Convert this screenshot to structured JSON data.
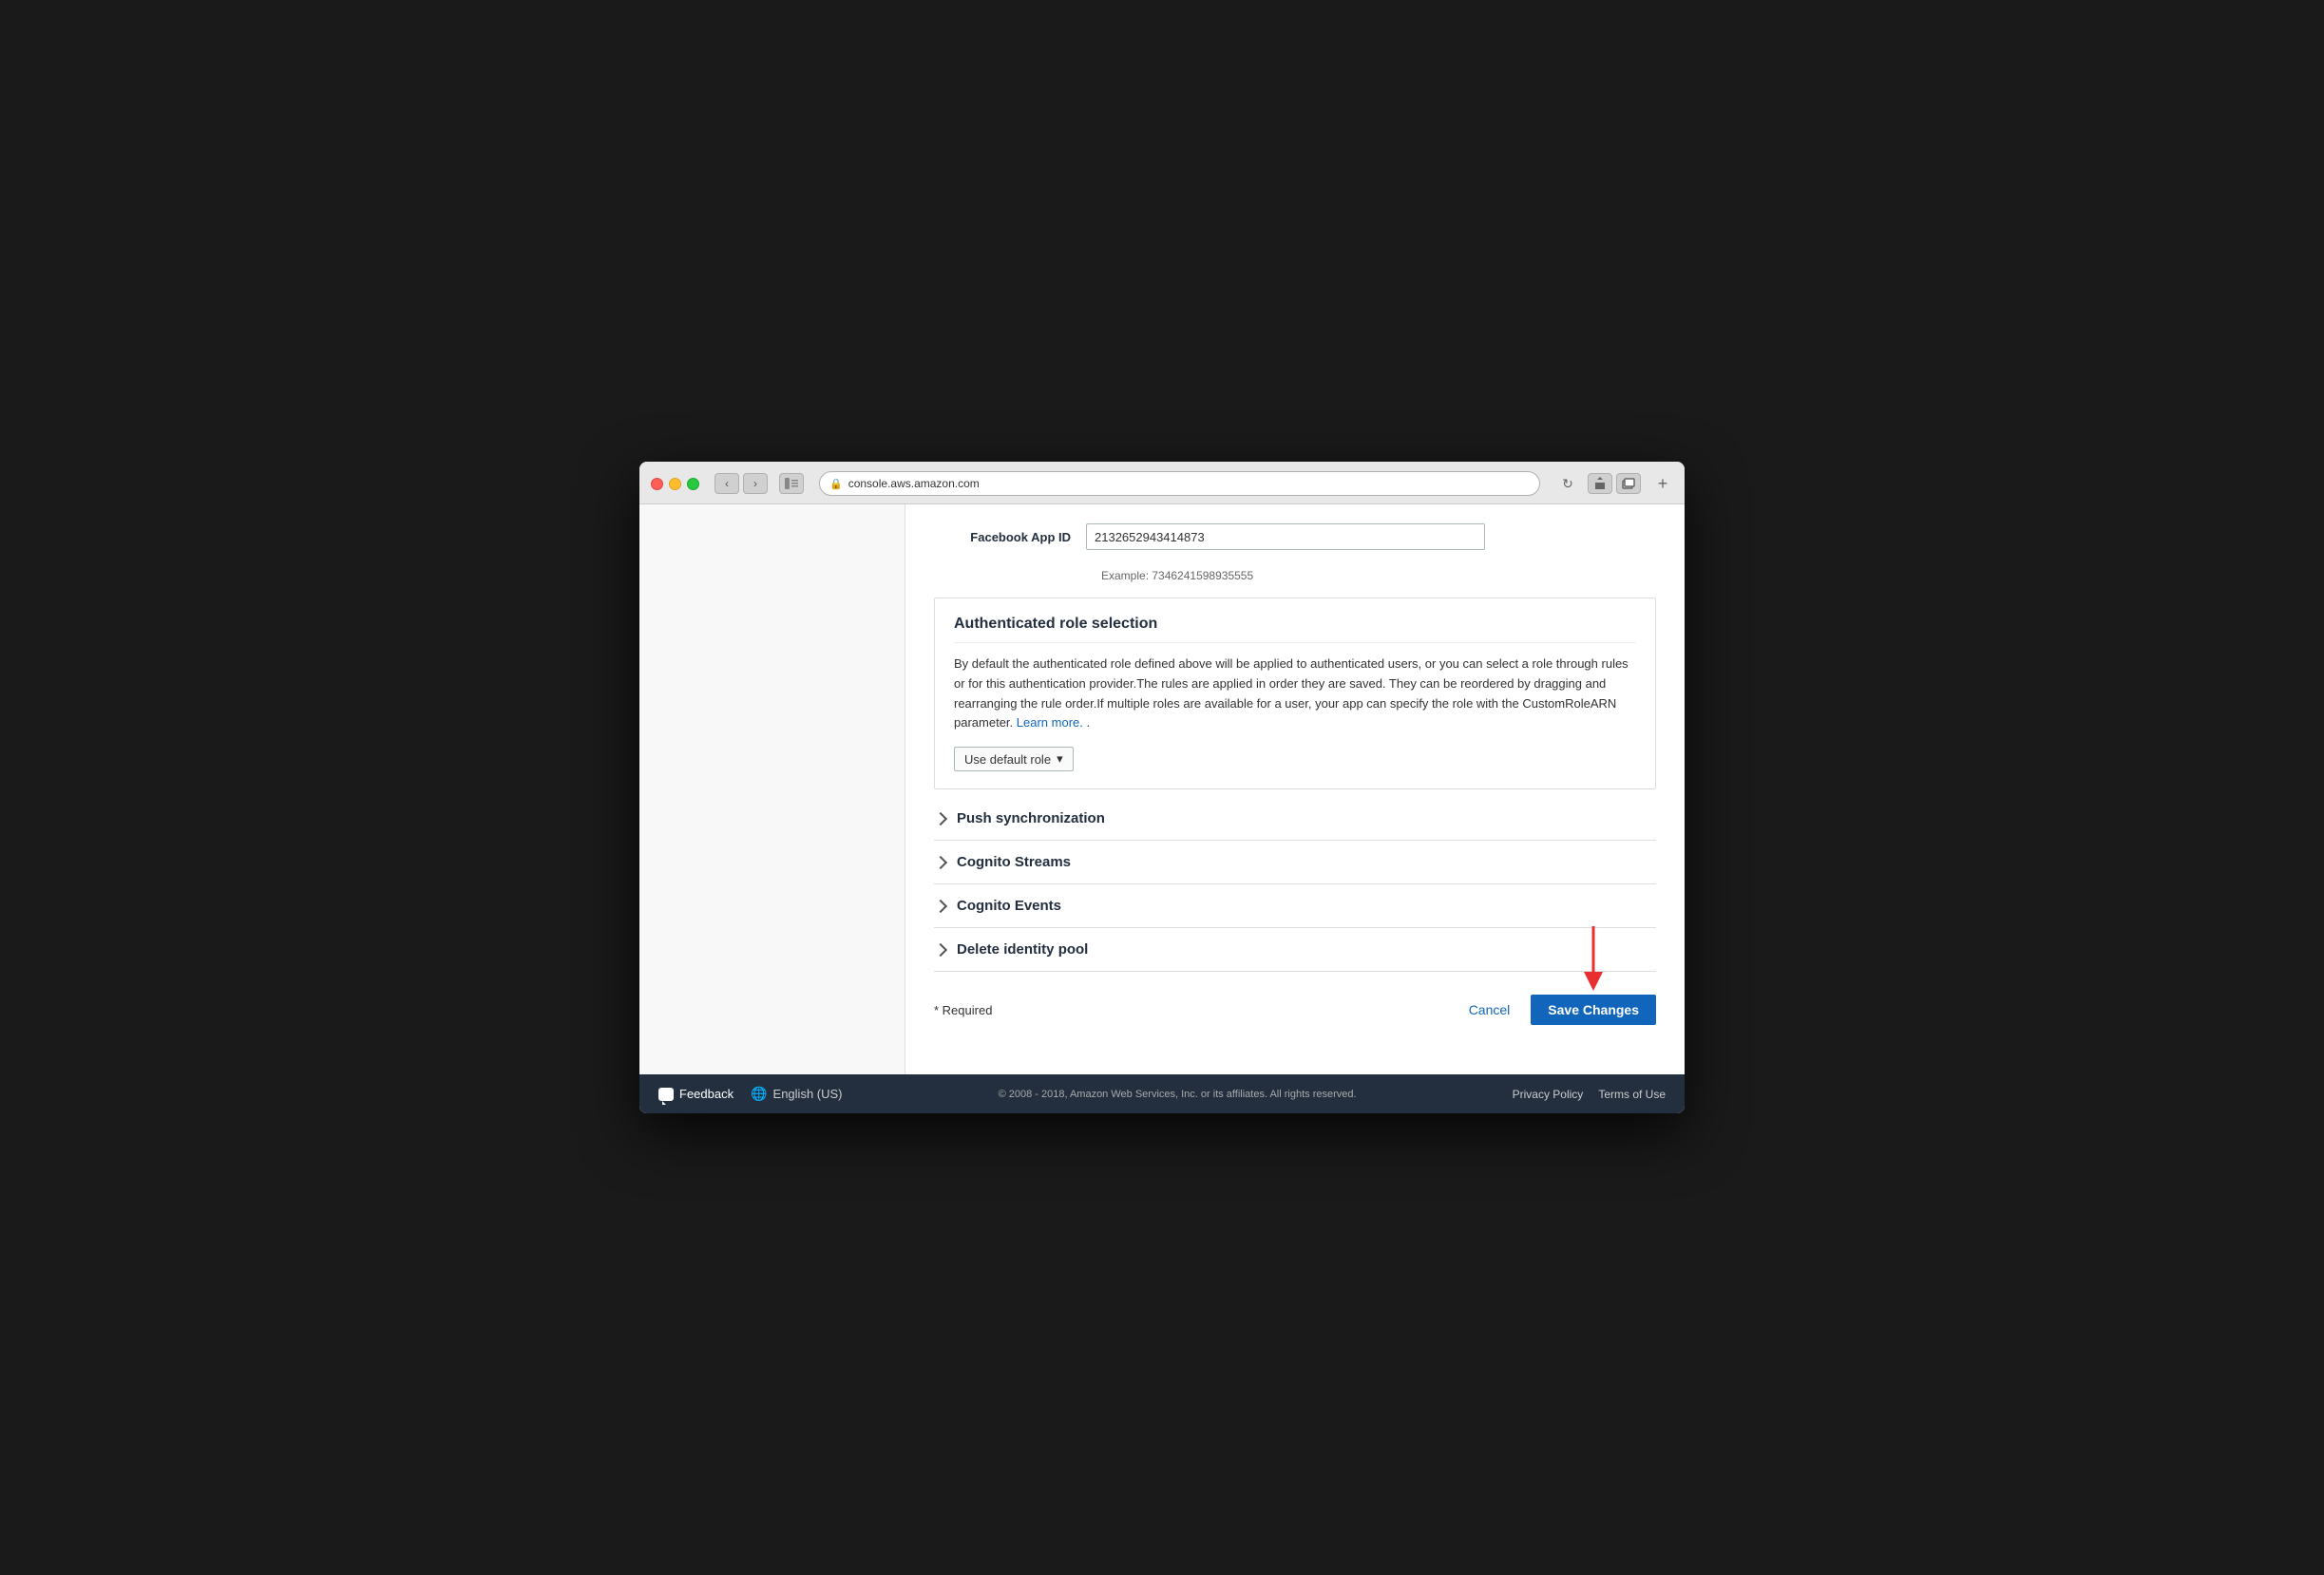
{
  "browser": {
    "url": "console.aws.amazon.com",
    "traffic_lights": [
      "red",
      "yellow",
      "green"
    ]
  },
  "page": {
    "facebook_app_id_label": "Facebook App ID",
    "facebook_app_id_value": "2132652943414873",
    "facebook_app_id_example": "Example: 7346241598935555",
    "authenticated_role_section": {
      "title": "Authenticated role selection",
      "description": "By default the authenticated role defined above will be applied to authenticated users, or you can select a role through rules or for this authentication provider.The rules are applied in order they are saved. They can be reordered by dragging and rearranging the rule order.If multiple roles are available for a user, your app can specify the role with the CustomRoleARN parameter.",
      "learn_more_text": "Learn more.",
      "default_role_btn": "Use default role"
    },
    "collapsible_sections": [
      {
        "label": "Push synchronization"
      },
      {
        "label": "Cognito Streams"
      },
      {
        "label": "Cognito Events"
      },
      {
        "label": "Delete identity pool"
      }
    ],
    "required_note": "* Required",
    "cancel_label": "Cancel",
    "save_label": "Save Changes"
  },
  "footer": {
    "feedback_label": "Feedback",
    "language_label": "English (US)",
    "copyright": "© 2008 - 2018, Amazon Web Services, Inc. or its affiliates. All rights reserved.",
    "privacy_policy": "Privacy Policy",
    "terms_of_use": "Terms of Use"
  }
}
